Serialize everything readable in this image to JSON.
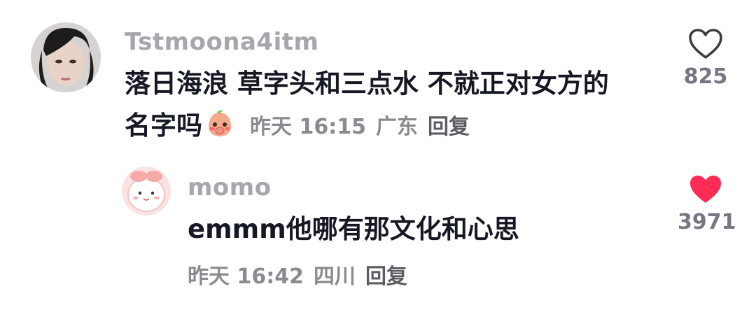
{
  "comment": {
    "username": "Tstmoona4itm",
    "text_line1": "落日海浪 草字头和三点水 不就正对女方的",
    "text_line2": "名字吗",
    "emoji_icon": "blushing-peach-emoji",
    "time": "昨天 16:15",
    "location": "广东",
    "reply_label": "回复",
    "like_count": "825",
    "liked": false
  },
  "reply": {
    "username": "momo",
    "text": "emmm他哪有那文化和心思",
    "time": "昨天 16:42",
    "location": "四川",
    "reply_label": "回复",
    "like_count": "3971",
    "liked": true
  },
  "colors": {
    "heart_outline": "#3a3b40",
    "heart_filled": "#fe2c55",
    "username": "#a6a6ad"
  }
}
